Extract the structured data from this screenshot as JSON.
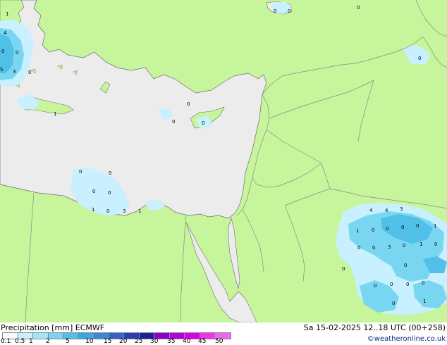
{
  "legend": {
    "title": "Precipitation [mm]",
    "model": "ECMWF",
    "labels": [
      "0.1",
      "0.5",
      "1",
      "2",
      "5",
      "10",
      "15",
      "20",
      "25",
      "30",
      "35",
      "40",
      "45",
      "50"
    ],
    "colors": [
      "#f5fbff",
      "#c8f0ff",
      "#a0e6fa",
      "#78d6f0",
      "#50c0e8",
      "#3ea6e0",
      "#3c86d6",
      "#3462c8",
      "#2a3eb4",
      "#1e1e9a",
      "#8c00d2",
      "#b400dc",
      "#dc00e6",
      "#f032f0",
      "#f064f0"
    ]
  },
  "timestamp": "Sa 15-02-2025 12..18 UTC (00+258)",
  "credit": "©weatheronline.co.uk",
  "colors": {
    "land": "#c7f59b",
    "sea": "#ececec",
    "border": "#8a8a8a",
    "coast": "#6e6e6e"
  },
  "map_labels": {
    "l1": "1",
    "l2": "4",
    "l3": "0",
    "l4": "0",
    "l5": "5",
    "l6": "3",
    "l7": "0",
    "l8": "1",
    "l9": "0",
    "l10": "0",
    "l11": "0",
    "l12": "0",
    "l13": "0",
    "l14": "0",
    "l15": "0",
    "l16": "1",
    "l17": "0",
    "l18": "0",
    "l19": "0",
    "l20": "0",
    "l21": "0",
    "l22": "3",
    "l23": "1",
    "l24": "4",
    "l25": "4",
    "l26": "3",
    "l27": "1",
    "l28": "0",
    "l29": "0",
    "l30": "0",
    "l31": "0",
    "l32": "1",
    "l33": "0",
    "l34": "0",
    "l35": "3",
    "l36": "0",
    "l37": "1",
    "l38": "0",
    "l39": "0",
    "l40": "0",
    "l41": "0",
    "l42": "0",
    "l43": "0",
    "l44": "0",
    "l45": "0",
    "l46": "1"
  }
}
